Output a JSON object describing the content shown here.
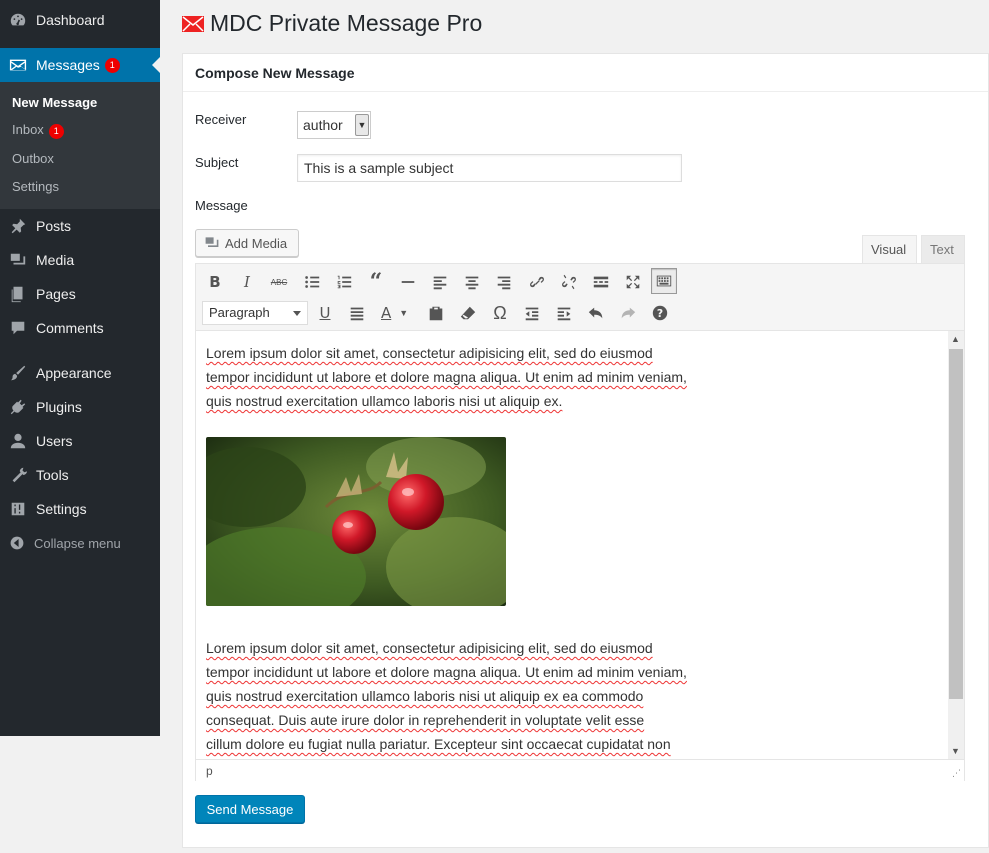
{
  "sidebar": {
    "dashboard": "Dashboard",
    "messages": "Messages",
    "messages_badge": "1",
    "submenu": {
      "new_message": "New Message",
      "inbox": "Inbox",
      "inbox_badge": "1",
      "outbox": "Outbox",
      "settings": "Settings"
    },
    "posts": "Posts",
    "media": "Media",
    "pages": "Pages",
    "comments": "Comments",
    "appearance": "Appearance",
    "plugins": "Plugins",
    "users": "Users",
    "tools": "Tools",
    "settings": "Settings",
    "collapse": "Collapse menu"
  },
  "page": {
    "title": "MDC Private Message Pro"
  },
  "compose": {
    "heading": "Compose New Message",
    "receiver_label": "Receiver",
    "receiver_value": "author",
    "subject_label": "Subject",
    "subject_value": "This is a sample subject",
    "message_label": "Message",
    "add_media": "Add Media",
    "tab_visual": "Visual",
    "tab_text": "Text",
    "format_value": "Paragraph",
    "paragraph1_lines": [
      "Lorem ipsum dolor sit amet, consectetur adipisicing elit, sed do eiusmod",
      "tempor incididunt ut labore et dolore magna aliqua. Ut enim ad minim veniam,",
      "quis nostrud exercitation ullamco laboris nisi ut aliquip ex."
    ],
    "paragraph2_lines": [
      "Lorem ipsum dolor sit amet, consectetur adipisicing elit, sed do eiusmod",
      "tempor incididunt ut labore et dolore magna aliqua. Ut enim ad minim veniam,",
      "quis nostrud exercitation ullamco laboris nisi ut aliquip ex ea commodo",
      "consequat. Duis aute irure dolor in reprehenderit in voluptate velit esse",
      "cillum dolore eu fugiat nulla pariatur. Excepteur sint occaecat cupidatat non"
    ],
    "status_path": "p",
    "send_button": "Send Message"
  },
  "colors": {
    "sidebar_bg": "#23282d",
    "accent": "#0073aa",
    "button": "#0085ba",
    "badge": "#e00000"
  }
}
